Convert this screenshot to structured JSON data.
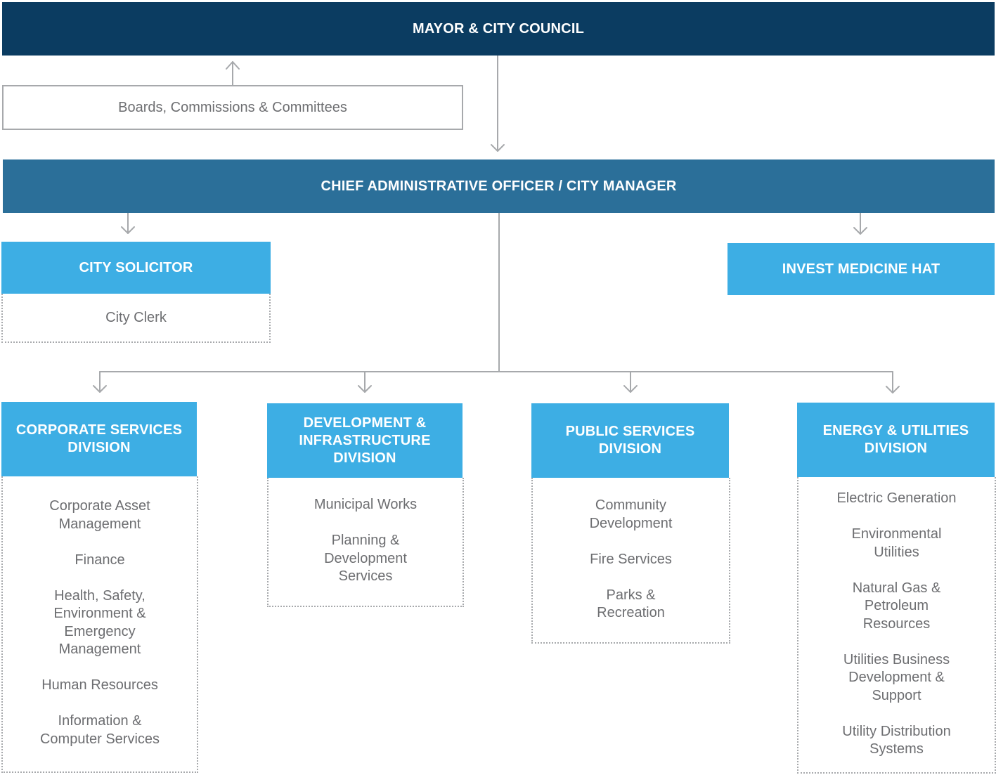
{
  "mayor": {
    "label": "MAYOR & CITY COUNCIL"
  },
  "boards": {
    "label": "Boards, Commissions & Committees"
  },
  "cao": {
    "label": "CHIEF ADMINISTRATIVE OFFICER / CITY MANAGER"
  },
  "solicitor": {
    "label": "CITY SOLICITOR",
    "items": [
      "City Clerk"
    ]
  },
  "invest": {
    "label": "INVEST MEDICINE HAT"
  },
  "divisions": [
    {
      "label": "CORPORATE SERVICES DIVISION",
      "items": [
        "Corporate Asset Management",
        "Finance",
        "Health, Safety, Environment & Emergency Management",
        "Human Resources",
        "Information & Computer Services"
      ]
    },
    {
      "label": "DEVELOPMENT & INFRASTRUCTURE DIVISION",
      "items": [
        "Municipal Works",
        "Planning & Development Services"
      ]
    },
    {
      "label": "PUBLIC SERVICES DIVISION",
      "items": [
        "Community Development",
        "Fire Services",
        "Parks & Recreation"
      ]
    },
    {
      "label": "ENERGY & UTILITIES DIVISION",
      "items": [
        "Electric Generation",
        "Environmental Utilities",
        "Natural Gas & Petroleum Resources",
        "Utilities Business Development & Support",
        "Utility Distribution Systems"
      ]
    }
  ],
  "colors": {
    "mayor": "#0b3c61",
    "cao": "#2b6f99",
    "unit": "#3daee4",
    "line": "#a7a9ac",
    "text": "#6d6e71"
  }
}
